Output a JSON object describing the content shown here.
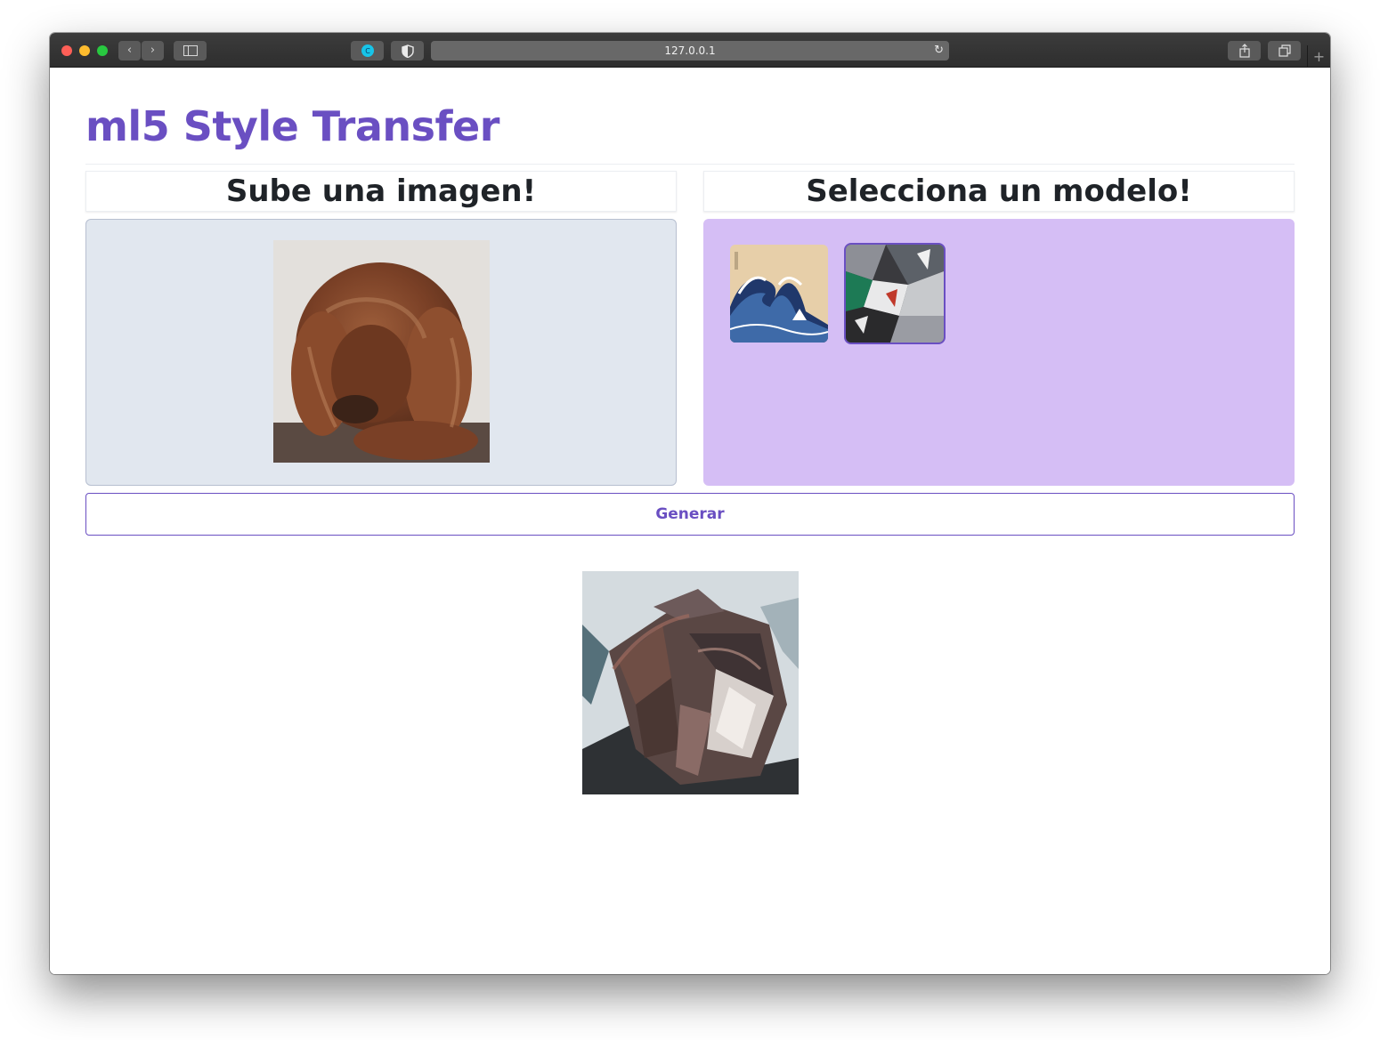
{
  "browser": {
    "url": "127.0.0.1",
    "reload_icon": "reload-icon",
    "back_icon": "chevron-left-icon",
    "forward_icon": "chevron-right-icon",
    "sidebar_icon": "sidebar-icon",
    "share_icon": "share-icon",
    "tabs_icon": "tabs-icon",
    "newtab_label": "+"
  },
  "page": {
    "title": "ml5 Style Transfer",
    "upload_heading": "Sube una imagen!",
    "model_heading": "Selecciona un modelo!",
    "generate_label": "Generar"
  },
  "models": [
    {
      "name": "wave",
      "selected": false
    },
    {
      "name": "cubist",
      "selected": true
    }
  ],
  "colors": {
    "accent": "#6a4fc2",
    "upload_bg": "#e1e7ef",
    "model_bg": "#d5bef5",
    "heading_text": "#1f2328"
  }
}
